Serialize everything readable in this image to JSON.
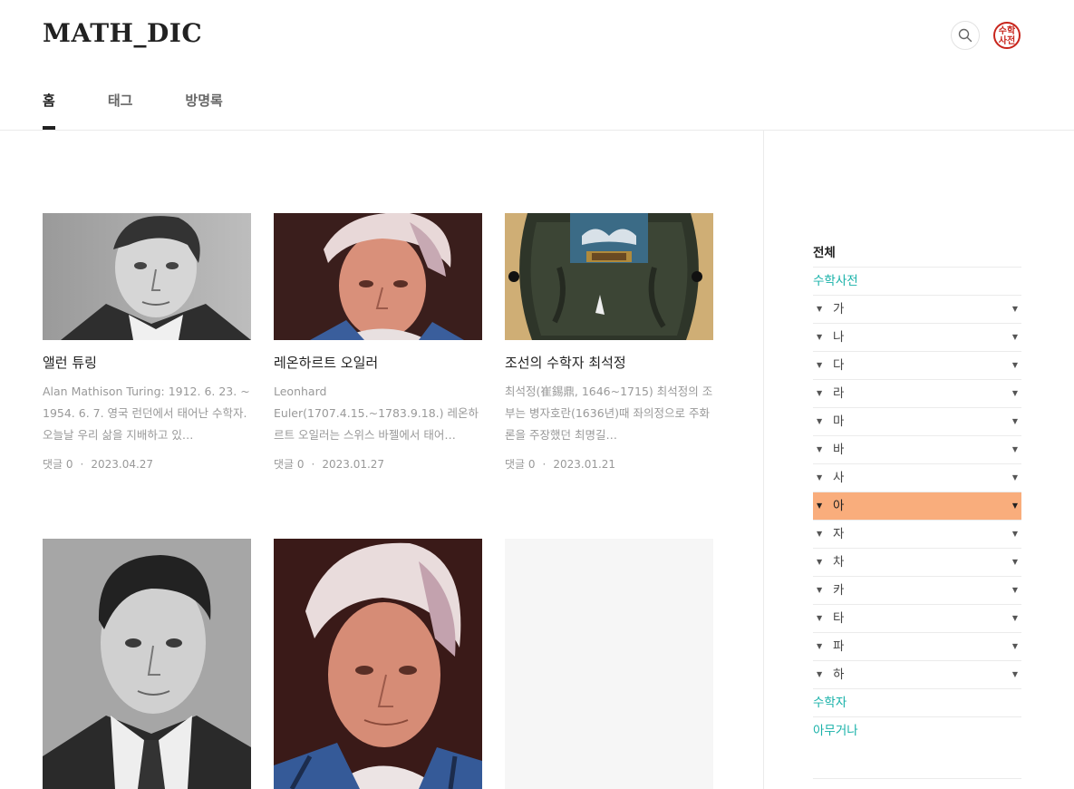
{
  "header": {
    "title": "MATH_DIC",
    "search_icon": "search-icon",
    "profile_text_1": "수학",
    "profile_text_2": "사전",
    "accent": "#c8251c"
  },
  "nav": {
    "items": [
      {
        "label": "홈",
        "active": true
      },
      {
        "label": "태그",
        "active": false
      },
      {
        "label": "방명록",
        "active": false
      }
    ]
  },
  "posts": [
    {
      "title": "앨런 튜링",
      "summary": "Alan Mathison Turing: 1912. 6. 23. ~ 1954. 6. 7. 영국 런던에서 태어난 수학자. 오늘날 우리 삶을 지배하고 있…",
      "comments": "댓글 0",
      "date": "2023.04.27"
    },
    {
      "title": "레온하르트 오일러",
      "summary": "Leonhard Euler(1707.4.15.~1783.9.18.) 레온하르트 오일러는 스위스 바젤에서 태어…",
      "comments": "댓글 0",
      "date": "2023.01.27"
    },
    {
      "title": "조선의 수학자 최석정",
      "summary": "최석정(崔錫鼎, 1646~1715) 최석정의 조부는 병자호란(1636년)때 좌의정으로 주화론을 주장했던 최명길…",
      "comments": "댓글 0",
      "date": "2023.01.21"
    }
  ],
  "sidebar": {
    "all_label": "전체",
    "main_category": "수학사전",
    "subcategories": [
      "가",
      "나",
      "다",
      "라",
      "마",
      "바",
      "사",
      "아",
      "자",
      "차",
      "카",
      "타",
      "파",
      "하"
    ],
    "highlighted": "아",
    "highlight_color": "#f9ad7c",
    "extra_categories": [
      "수학자",
      "아무거나"
    ],
    "teal_color": "#19b2a9"
  }
}
